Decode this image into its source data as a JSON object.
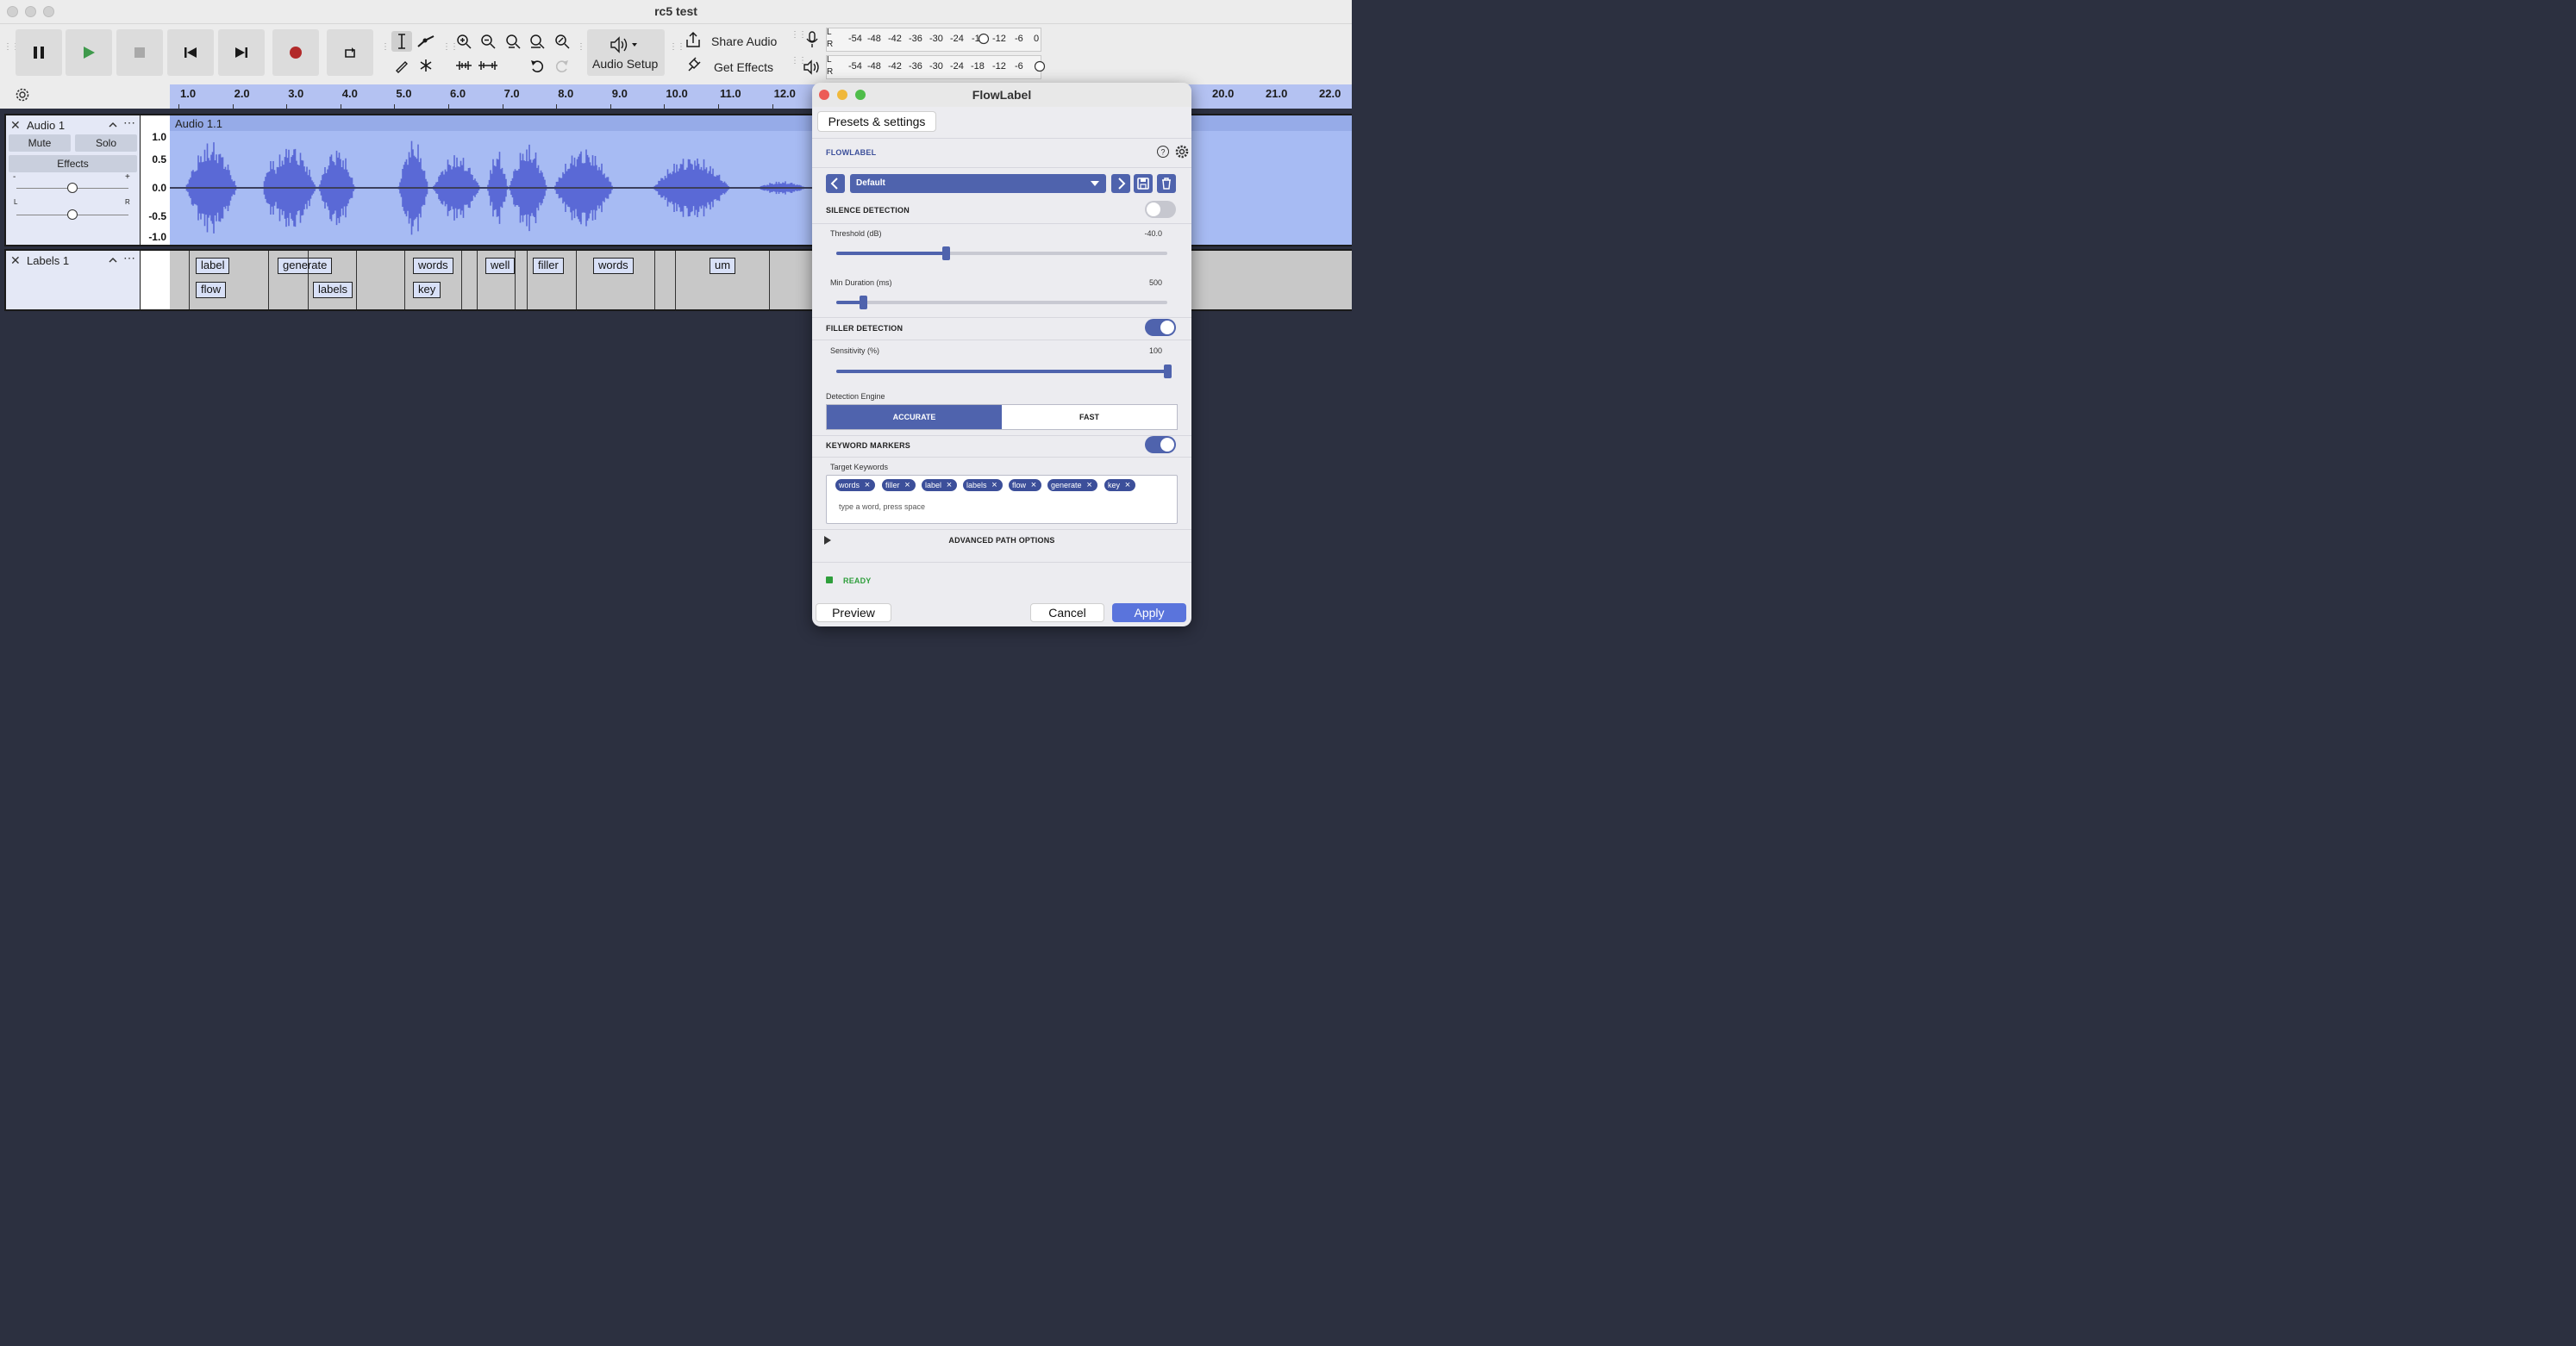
{
  "window": {
    "title": "rc5 test"
  },
  "toolbar": {
    "transport": [
      "pause",
      "play",
      "stop",
      "skip-start",
      "skip-end",
      "record",
      "loop"
    ],
    "share_audio": "Share Audio",
    "get_effects": "Get Effects",
    "audio_setup": "Audio Setup",
    "meter_scale_top": [
      "-54",
      "-48",
      "-42",
      "-36",
      "-30",
      "-24",
      "-1",
      "-12",
      "-6",
      "0"
    ],
    "meter_scale_bottom": [
      "-54",
      "-48",
      "-42",
      "-36",
      "-30",
      "-24",
      "-18",
      "-12",
      "-6"
    ],
    "meter_lr_top": [
      "L",
      "R"
    ],
    "meter_lr_bottom": [
      "L",
      "R"
    ]
  },
  "ruler": {
    "ticks_left": [
      "1.0",
      "2.0",
      "3.0",
      "4.0",
      "5.0",
      "6.0",
      "7.0",
      "8.0",
      "9.0",
      "10.0",
      "11.0",
      "12.0"
    ],
    "ticks_right": [
      "20.0",
      "21.0",
      "22.0"
    ]
  },
  "audio_track": {
    "name": "Audio 1",
    "mute": "Mute",
    "solo": "Solo",
    "effects": "Effects",
    "gain_minus": "-",
    "gain_plus": "+",
    "pan_left": "L",
    "pan_right": "R",
    "clip_name": "Audio 1.1",
    "scale": [
      "1.0",
      "0.5",
      "0.0",
      "-0.5",
      "-1.0"
    ]
  },
  "label_track": {
    "name": "Labels 1",
    "labels": [
      "label",
      "flow",
      "generate",
      "labels",
      "words",
      "key",
      "well",
      "filler",
      "words",
      "um"
    ]
  },
  "dialog": {
    "title": "FlowLabel",
    "tab": "Presets & settings",
    "header": "FLOWLABEL",
    "preset": "Default",
    "silence": {
      "title": "SILENCE DETECTION",
      "enabled": false,
      "threshold_label": "Threshold (dB)",
      "threshold_value": "-40.0",
      "threshold_fraction": 0.33,
      "min_duration_label": "Min Duration (ms)",
      "min_duration_value": "500",
      "min_duration_fraction": 0.08
    },
    "filler": {
      "title": "FILLER DETECTION",
      "enabled": true,
      "sensitivity_label": "Sensitivity (%)",
      "sensitivity_value": "100",
      "sensitivity_fraction": 1.0,
      "engine_label": "Detection Engine",
      "engine_accurate": "ACCURATE",
      "engine_fast": "FAST"
    },
    "keywords": {
      "title": "KEYWORD MARKERS",
      "enabled": true,
      "target_label": "Target Keywords",
      "chips": [
        "words",
        "filler",
        "label",
        "labels",
        "flow",
        "generate",
        "key"
      ],
      "placeholder": "type a word, press space"
    },
    "advanced": "ADVANCED PATH OPTIONS",
    "status": "READY",
    "status_color": "#2e9e3b",
    "preview": "Preview",
    "cancel": "Cancel",
    "apply": "Apply",
    "accent": "#4f63ad"
  }
}
